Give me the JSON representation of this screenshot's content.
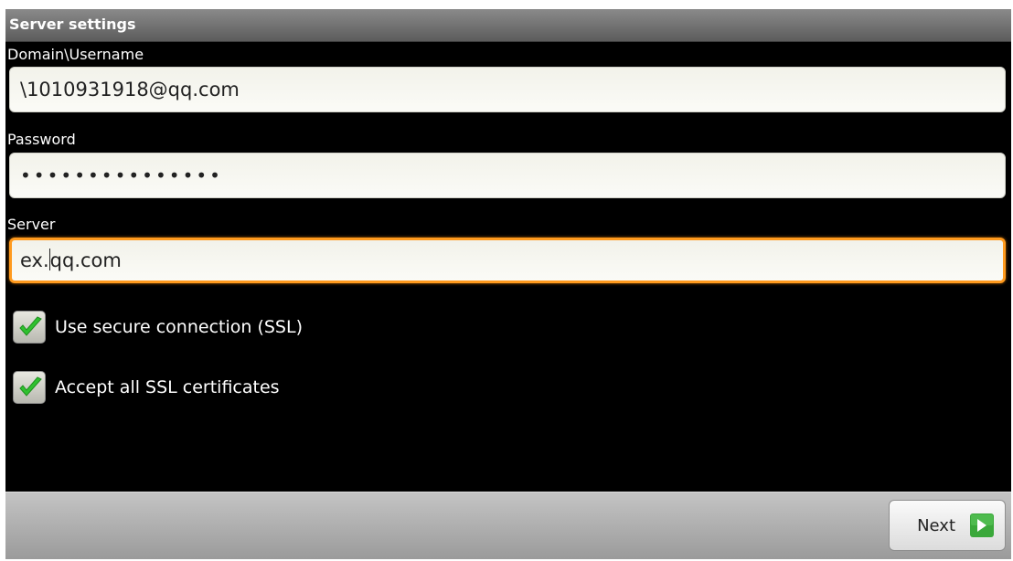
{
  "title": "Server settings",
  "fields": {
    "username": {
      "label": "Domain\\Username",
      "value": "\\1010931918@qq.com"
    },
    "password": {
      "label": "Password",
      "value": "•••••••••••••••"
    },
    "server": {
      "label": "Server",
      "value_before_cursor": "ex.",
      "value_after_cursor": "qq.com"
    }
  },
  "checkboxes": {
    "ssl": {
      "label": "Use secure connection (SSL)",
      "checked": true
    },
    "accept_certs": {
      "label": "Accept all SSL certificates",
      "checked": true
    }
  },
  "actions": {
    "next_label": "Next"
  },
  "icons": {
    "checkmark": "check-icon",
    "next": "arrow-right-icon"
  },
  "colors": {
    "focus_border": "#ff9a1e",
    "checkmark": "#2fc12f",
    "next_arrow_bg": "#3aa83a"
  }
}
